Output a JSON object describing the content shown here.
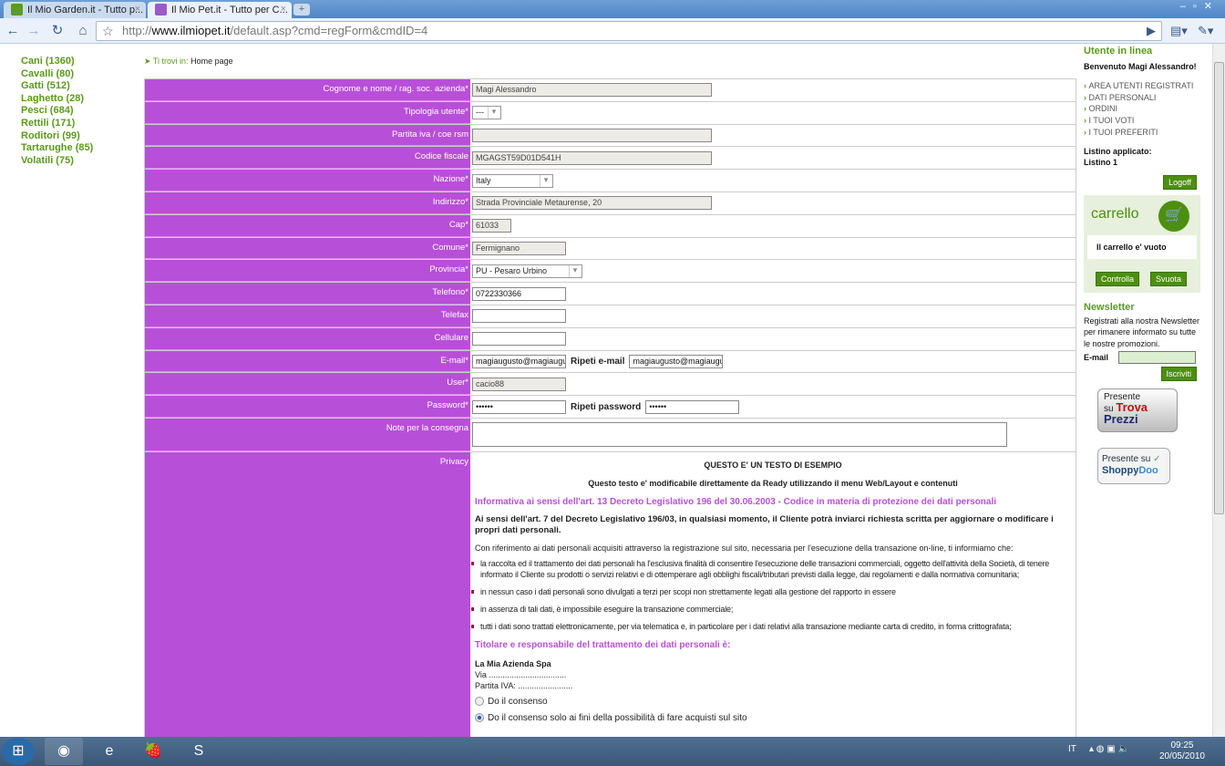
{
  "browser": {
    "tabs": [
      {
        "label": "Il Mio Garden.it - Tutto p..."
      },
      {
        "label": "Il Mio Pet.it - Tutto per C..."
      }
    ],
    "url_scheme": "http://",
    "url_host": "www.ilmiopet.it",
    "url_path": "/default.asp?cmd=regForm&cmdID=4"
  },
  "leftnav": [
    "Cani (1360)",
    "Cavalli (80)",
    "Gatti (512)",
    "Laghetto (28)",
    "Pesci (684)",
    "Rettili (171)",
    "Roditori (99)",
    "Tartarughe (85)",
    "Volatili (75)"
  ],
  "breadcrumb": {
    "label": "Ti trovi in:",
    "value": "Home page"
  },
  "form": {
    "cognome": {
      "label": "Cognome e nome / rag. soc. azienda*",
      "value": "Magi Alessandro"
    },
    "tipologia": {
      "label": "Tipologia utente*",
      "value": "---"
    },
    "piva": {
      "label": "Partita iva / coe rsm",
      "value": ""
    },
    "cf": {
      "label": "Codice fiscale",
      "value": "MGAGST59D01D541H"
    },
    "nazione": {
      "label": "Nazione*",
      "value": "Italy"
    },
    "indirizzo": {
      "label": "Indirizzo*",
      "value": "Strada Provinciale Metaurense, 20"
    },
    "cap": {
      "label": "Cap*",
      "value": "61033"
    },
    "comune": {
      "label": "Comune*",
      "value": "Fermignano"
    },
    "provincia": {
      "label": "Provincia*",
      "value": "PU - Pesaro Urbino"
    },
    "telefono": {
      "label": "Telefono*",
      "value": "0722330366"
    },
    "telefax": {
      "label": "Telefax",
      "value": ""
    },
    "cellulare": {
      "label": "Cellulare",
      "value": ""
    },
    "email": {
      "label": "E-mail*",
      "value": "magiaugusto@magiaugus",
      "repeat_label": "Ripeti e-mail",
      "repeat_value": "magiaugusto@magiaugus"
    },
    "user": {
      "label": "User*",
      "value": "cacio88"
    },
    "password": {
      "label": "Password*",
      "value": "••••••",
      "repeat_label": "Ripeti password",
      "repeat_value": "••••••"
    },
    "note": {
      "label": "Note per la consegna",
      "value": ""
    },
    "privacy_label": "Privacy"
  },
  "privacy": {
    "title": "QUESTO E' UN TESTO DI ESEMPIO",
    "subtitle": "Questo testo e' modificabile direttamente da Ready utilizzando il menu Web/Layout e contenuti",
    "heading1": "Informativa ai sensi dell'art. 13 Decreto Legislativo 196 del 30.06.2003 - Codice in materia di protezione dei dati personali",
    "bold": "Ai sensi dell'art. 7 del Decreto Legislativo 196/03, in qualsiasi momento, il Cliente potrà inviarci richiesta scritta per aggiornare o modificare i propri dati personali.",
    "intro": "Con riferimento ai dati personali acquisiti attraverso la registrazione sul sito, necessaria per l'esecuzione della transazione on-line, ti informiamo che:",
    "items": [
      "la raccolta ed il trattamento dei dati personali ha l'esclusiva finalità di consentire l'esecuzione delle transazioni commerciali, oggetto dell'attività della Società, di tenere informato il Cliente su prodotti o servizi relativi e di ottemperare agli obblighi fiscali/tributari previsti dalla legge, dai regolamenti e dalla normativa comunitaria;",
      "in nessun caso i dati personali sono divulgati a terzi per scopi non strettamente legati alla gestione del rapporto in essere",
      "in assenza di tali dati, è impossibile eseguire la transazione commerciale;",
      "tutti i dati sono trattati elettronicamente, per via telematica e, in particolare per i dati relativi alla transazione mediante carta di credito, in forma crittografata;"
    ],
    "heading2": "Titolare e responsabile del trattamento dei dati personali è:",
    "company": "La Mia Azienda Spa",
    "via": "Via ..................................",
    "piva": "Partita IVA: ........................",
    "radio1": "Do il consenso",
    "radio2": "Do il consenso solo ai fini della possibilità di fare acquisti sul sito"
  },
  "sidebar": {
    "title": "Utente in linea",
    "welcome": "Benvenuto Magi Alessandro!",
    "menu": [
      "AREA UTENTI REGISTRATI",
      "DATI PERSONALI",
      "ORDINI",
      "I TUOI VOTI",
      "I TUOI PREFERITI"
    ],
    "listino_label": "Listino applicato:",
    "listino": "Listino 1",
    "logoff": "Logoff",
    "cart_title": "carrello",
    "cart_empty": "Il carrello e' vuoto",
    "controlla": "Controlla",
    "svuota": "Svuota",
    "newsletter_title": "Newsletter",
    "newsletter_text": "Registrati alla nostra Newsletter per rimanere informato su tutte le nostre promozioni.",
    "email_label": "E-mail",
    "iscriviti": "Iscriviti",
    "badge1": "Presente su TrovaPrezzi",
    "badge2": "Presente su ShoppyDoo"
  },
  "taskbar": {
    "lang": "IT",
    "time": "09:25",
    "date": "20/05/2010"
  }
}
